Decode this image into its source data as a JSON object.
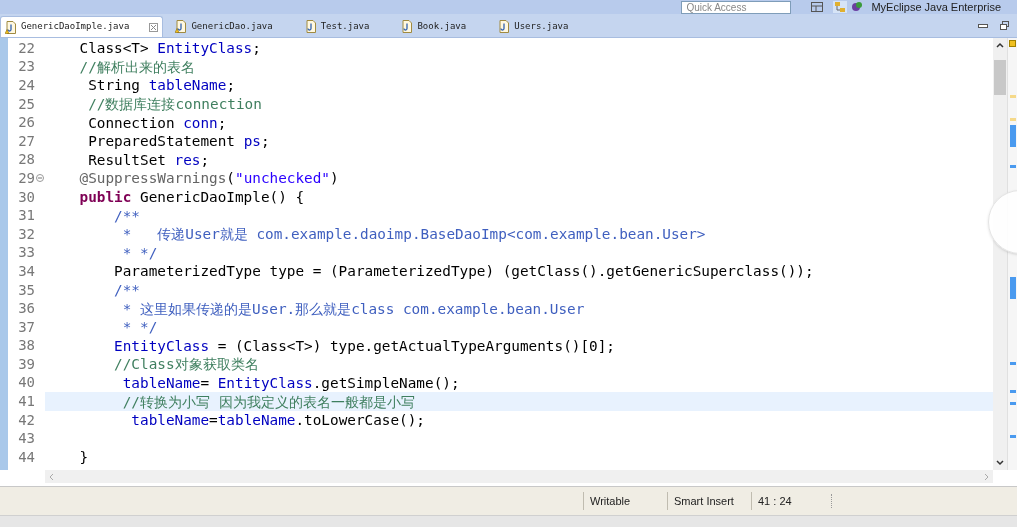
{
  "toolbar": {
    "quick_access": {
      "placeholder": "Quick Access"
    },
    "perspective": "MyEclipse Java Enterprise"
  },
  "tabs": [
    {
      "label": "GenericDaoImple.java",
      "selected": true,
      "warning": true
    },
    {
      "label": "GenericDao.java",
      "selected": false,
      "warning": true
    },
    {
      "label": "Test.java",
      "selected": false,
      "warning": false
    },
    {
      "label": "Book.java",
      "selected": false,
      "warning": false
    },
    {
      "label": "Users.java",
      "selected": false,
      "warning": false
    }
  ],
  "editor": {
    "lines": [
      {
        "number": "22",
        "fold": false,
        "current": false,
        "segments": [
          {
            "kind": "plain",
            "text": "    Class<T> "
          },
          {
            "kind": "field",
            "text": "EntityClass"
          },
          {
            "kind": "plain",
            "text": ";"
          }
        ]
      },
      {
        "number": "23",
        "fold": false,
        "current": false,
        "segments": [
          {
            "kind": "comment",
            "text": "    //解析出来的表名"
          }
        ]
      },
      {
        "number": "24",
        "fold": false,
        "current": false,
        "segments": [
          {
            "kind": "plain",
            "text": "     String "
          },
          {
            "kind": "field",
            "text": "tableName"
          },
          {
            "kind": "plain",
            "text": ";"
          }
        ]
      },
      {
        "number": "25",
        "fold": false,
        "current": false,
        "segments": [
          {
            "kind": "comment",
            "text": "     //数据库连接connection"
          }
        ]
      },
      {
        "number": "26",
        "fold": false,
        "current": false,
        "segments": [
          {
            "kind": "plain",
            "text": "     Connection "
          },
          {
            "kind": "field",
            "text": "conn"
          },
          {
            "kind": "plain",
            "text": ";"
          }
        ]
      },
      {
        "number": "27",
        "fold": false,
        "current": false,
        "segments": [
          {
            "kind": "plain",
            "text": "     PreparedStatement "
          },
          {
            "kind": "field",
            "text": "ps"
          },
          {
            "kind": "plain",
            "text": ";"
          }
        ]
      },
      {
        "number": "28",
        "fold": false,
        "current": false,
        "segments": [
          {
            "kind": "plain",
            "text": "     ResultSet "
          },
          {
            "kind": "field",
            "text": "res"
          },
          {
            "kind": "plain",
            "text": ";"
          }
        ]
      },
      {
        "number": "29",
        "fold": true,
        "current": false,
        "segments": [
          {
            "kind": "annotation",
            "text": "    @SuppressWarnings"
          },
          {
            "kind": "plain",
            "text": "("
          },
          {
            "kind": "string",
            "text": "\"unchecked\""
          },
          {
            "kind": "plain",
            "text": ")"
          }
        ]
      },
      {
        "number": "30",
        "fold": false,
        "current": false,
        "segments": [
          {
            "kind": "keyword",
            "text": "    public"
          },
          {
            "kind": "plain",
            "text": " GenericDaoImple() {"
          }
        ]
      },
      {
        "number": "31",
        "fold": false,
        "current": false,
        "segments": [
          {
            "kind": "javadoc",
            "text": "        /**"
          }
        ]
      },
      {
        "number": "32",
        "fold": false,
        "current": false,
        "segments": [
          {
            "kind": "javadoc",
            "text": "         *   传递User就是 com.example.daoimp.BaseDaoImp<com.example.bean.User>"
          }
        ]
      },
      {
        "number": "33",
        "fold": false,
        "current": false,
        "segments": [
          {
            "kind": "javadoc",
            "text": "         * */"
          }
        ]
      },
      {
        "number": "34",
        "fold": false,
        "current": false,
        "segments": [
          {
            "kind": "plain",
            "text": "        ParameterizedType type = (ParameterizedType) (getClass().getGenericSuperclass());"
          }
        ]
      },
      {
        "number": "35",
        "fold": false,
        "current": false,
        "segments": [
          {
            "kind": "javadoc",
            "text": "        /**"
          }
        ]
      },
      {
        "number": "36",
        "fold": false,
        "current": false,
        "segments": [
          {
            "kind": "javadoc",
            "text": "         * 这里如果传递的是User.那么就是class com.example.bean.User"
          }
        ]
      },
      {
        "number": "37",
        "fold": false,
        "current": false,
        "segments": [
          {
            "kind": "javadoc",
            "text": "         * */"
          }
        ]
      },
      {
        "number": "38",
        "fold": false,
        "current": false,
        "segments": [
          {
            "kind": "field",
            "text": "        EntityClass"
          },
          {
            "kind": "plain",
            "text": " = (Class<T>) type.getActualTypeArguments()[0];"
          }
        ]
      },
      {
        "number": "39",
        "fold": false,
        "current": false,
        "segments": [
          {
            "kind": "comment",
            "text": "        //Class对象获取类名"
          }
        ]
      },
      {
        "number": "40",
        "fold": false,
        "current": false,
        "segments": [
          {
            "kind": "field",
            "text": "         tableName"
          },
          {
            "kind": "plain",
            "text": "= "
          },
          {
            "kind": "field",
            "text": "EntityClass"
          },
          {
            "kind": "plain",
            "text": ".getSimpleName();"
          }
        ]
      },
      {
        "number": "41",
        "fold": false,
        "current": true,
        "segments": [
          {
            "kind": "comment",
            "text": "         //转换为小写 因为我定义的表名一般都是小写"
          }
        ]
      },
      {
        "number": "42",
        "fold": false,
        "current": false,
        "segments": [
          {
            "kind": "field",
            "text": "          tableName"
          },
          {
            "kind": "plain",
            "text": "="
          },
          {
            "kind": "field",
            "text": "tableName"
          },
          {
            "kind": "plain",
            "text": ".toLowerCase();"
          }
        ]
      },
      {
        "number": "43",
        "fold": false,
        "current": false
      },
      {
        "number": "44",
        "fold": false,
        "current": false,
        "segments": [
          {
            "kind": "plain",
            "text": "    }"
          }
        ]
      }
    ]
  },
  "status_bar": [
    {
      "text": "Writable"
    },
    {
      "text": "Smart Insert"
    },
    {
      "text": "41 : 24"
    }
  ]
}
